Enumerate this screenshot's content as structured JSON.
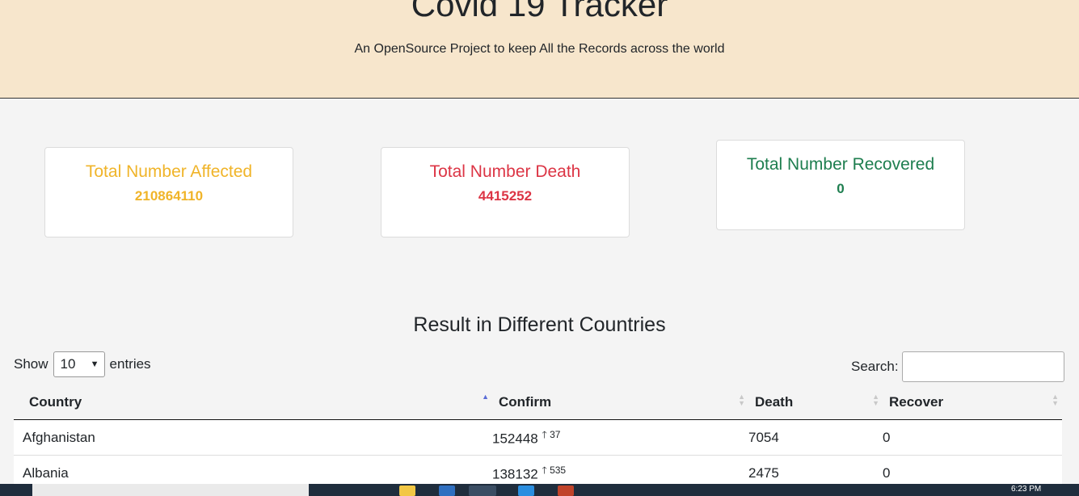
{
  "header": {
    "title": "Covid 19 Tracker",
    "subtitle": "An OpenSource Project to keep All the Records across the world"
  },
  "cards": {
    "affected": {
      "label": "Total Number Affected",
      "value": "210864110",
      "color": "#f0b429"
    },
    "death": {
      "label": "Total Number Death",
      "value": "4415252",
      "color": "#dc3545"
    },
    "recovered": {
      "label": "Total Number Recovered",
      "value": "0",
      "color": "#1e7e4f"
    }
  },
  "section_title": "Result in Different Countries",
  "table_controls": {
    "show_label": "Show",
    "entries_value": "10",
    "entries_label": "entries",
    "search_label": "Search:"
  },
  "table": {
    "headers": [
      "Country",
      "Confirm",
      "Death",
      "Recover"
    ],
    "rows": [
      {
        "country": "Afghanistan",
        "confirm": "152448",
        "new": "37",
        "death": "7054",
        "recover": "0"
      },
      {
        "country": "Albania",
        "confirm": "138132",
        "new": "535",
        "death": "2475",
        "recover": "0"
      }
    ]
  },
  "taskbar": {
    "time": "6:23 PM"
  }
}
